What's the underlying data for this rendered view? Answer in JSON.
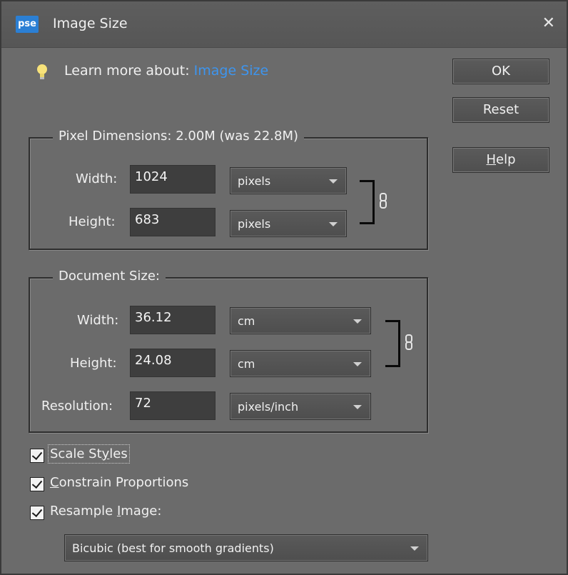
{
  "window": {
    "title": "Image Size",
    "app_icon_text": "pse"
  },
  "learn_more": {
    "prefix": "Learn more about:",
    "link": "Image Size"
  },
  "buttons": {
    "ok": "OK",
    "reset": "Reset",
    "help_pre": "",
    "help_u": "H",
    "help_post": "elp"
  },
  "pixel_dimensions": {
    "legend": "Pixel Dimensions:  2.00M (was 22.8M)",
    "width_label": "Width:",
    "width_value": "1024",
    "width_unit": "pixels",
    "height_label": "Height:",
    "height_value": "683",
    "height_unit": "pixels"
  },
  "document_size": {
    "legend": "Document Size:",
    "width_label": "Width:",
    "width_value": "36.12",
    "width_unit": "cm",
    "height_label": "Height:",
    "height_value": "24.08",
    "height_unit": "cm",
    "resolution_label": "Resolution:",
    "resolution_value": "72",
    "resolution_unit": "pixels/inch"
  },
  "options": {
    "scale_styles": {
      "pre": "Scale St",
      "u": "y",
      "post": "les",
      "checked": true
    },
    "constrain": {
      "pre": "",
      "u": "C",
      "post": "onstrain Proportions",
      "checked": true
    },
    "resample": {
      "pre": "Resample ",
      "u": "I",
      "post": "mage:",
      "checked": true
    }
  },
  "resample_method": "Bicubic (best for smooth gradients)",
  "colors": {
    "background": "#6b6b6b",
    "link": "#3d95ef",
    "field": "#3e3e3e"
  }
}
